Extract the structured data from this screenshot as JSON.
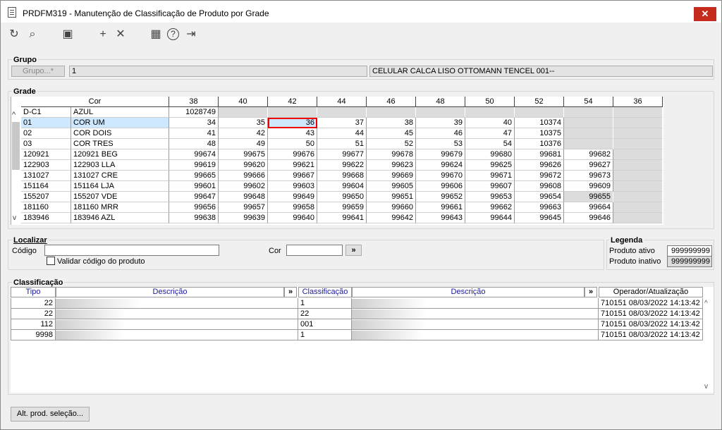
{
  "window": {
    "title": "PRDFM319 - Manutenção de Classificação de Produto por Grade",
    "close": "✕"
  },
  "toolbar": {
    "icons": [
      "refresh-icon",
      "search-icon",
      "save-icon",
      "add-icon",
      "delete-icon",
      "calendar-icon",
      "help-icon",
      "exit-icon"
    ],
    "glyphs": {
      "refresh": "↻",
      "search": "⌕",
      "save": "▣",
      "add": "+",
      "delete": "✕",
      "calendar": "▦",
      "help": "?",
      "exit": "⇥"
    }
  },
  "grupo": {
    "title": "Grupo",
    "button": "Grupo...*",
    "code": "1",
    "description": "CELULAR CALCA LISO OTTOMANN TENCEL 001--"
  },
  "grade": {
    "title": "Grade",
    "col_header": "Cor",
    "sizes": [
      "38",
      "40",
      "42",
      "44",
      "46",
      "48",
      "50",
      "52",
      "54",
      "36"
    ],
    "rows": [
      {
        "code": "D-C1",
        "name": "AZUL",
        "vals": [
          "1028749",
          "",
          "",
          "",
          "",
          "",
          "",
          "",
          "",
          ""
        ]
      },
      {
        "code": "01",
        "name": "COR UM",
        "vals": [
          "34",
          "35",
          "36",
          "37",
          "38",
          "39",
          "40",
          "10374",
          "",
          ""
        ]
      },
      {
        "code": "02",
        "name": "COR DOIS",
        "vals": [
          "41",
          "42",
          "43",
          "44",
          "45",
          "46",
          "47",
          "10375",
          "",
          ""
        ]
      },
      {
        "code": "03",
        "name": "COR TRES",
        "vals": [
          "48",
          "49",
          "50",
          "51",
          "52",
          "53",
          "54",
          "10376",
          "",
          ""
        ]
      },
      {
        "code": "120921",
        "name": "120921 BEG",
        "vals": [
          "99674",
          "99675",
          "99676",
          "99677",
          "99678",
          "99679",
          "99680",
          "99681",
          "99682",
          ""
        ]
      },
      {
        "code": "122903",
        "name": "122903 LLA",
        "vals": [
          "99619",
          "99620",
          "99621",
          "99622",
          "99623",
          "99624",
          "99625",
          "99626",
          "99627",
          ""
        ]
      },
      {
        "code": "131027",
        "name": "131027 CRE",
        "vals": [
          "99665",
          "99666",
          "99667",
          "99668",
          "99669",
          "99670",
          "99671",
          "99672",
          "99673",
          ""
        ]
      },
      {
        "code": "151164",
        "name": "151164 LJA",
        "vals": [
          "99601",
          "99602",
          "99603",
          "99604",
          "99605",
          "99606",
          "99607",
          "99608",
          "99609",
          ""
        ]
      },
      {
        "code": "155207",
        "name": "155207 VDE",
        "vals": [
          "99647",
          "99648",
          "99649",
          "99650",
          "99651",
          "99652",
          "99653",
          "99654",
          "99655",
          ""
        ]
      },
      {
        "code": "181160",
        "name": "181160 MRR",
        "vals": [
          "99656",
          "99657",
          "99658",
          "99659",
          "99660",
          "99661",
          "99662",
          "99663",
          "99664",
          ""
        ]
      },
      {
        "code": "183946",
        "name": "183946 AZL",
        "vals": [
          "99638",
          "99639",
          "99640",
          "99641",
          "99642",
          "99643",
          "99644",
          "99645",
          "99646",
          ""
        ]
      }
    ],
    "scroll_up": "^",
    "scroll_down": "v"
  },
  "localizar": {
    "title": "Localizar",
    "codigo_label": "Código",
    "codigo_value": "",
    "cor_label": "Cor",
    "cor_value": "",
    "go_button": "»",
    "checkbox_label": "Validar código do produto"
  },
  "legenda": {
    "title": "Legenda",
    "ativo_label": "Produto ativo",
    "ativo_value": "999999999",
    "inativo_label": "Produto inativo",
    "inativo_value": "999999999"
  },
  "classificacao": {
    "title": "Classificação",
    "headers": {
      "tipo": "Tipo",
      "descricao": "Descrição",
      "expand": "»",
      "classificacao": "Classificação",
      "descricao2": "Descrição",
      "expand2": "»",
      "operador": "Operador/Atualização"
    },
    "rows": [
      {
        "tipo": "22",
        "classificacao": "1",
        "operador": "710151 08/03/2022 14:13:42"
      },
      {
        "tipo": "22",
        "classificacao": "22",
        "operador": "710151 08/03/2022 14:13:42"
      },
      {
        "tipo": "112",
        "classificacao": "001",
        "operador": "710151 08/03/2022 14:13:42"
      },
      {
        "tipo": "9998",
        "classificacao": "1",
        "operador": "710151 08/03/2022 14:13:42"
      }
    ]
  },
  "footer": {
    "button": "Alt. prod. seleção..."
  }
}
